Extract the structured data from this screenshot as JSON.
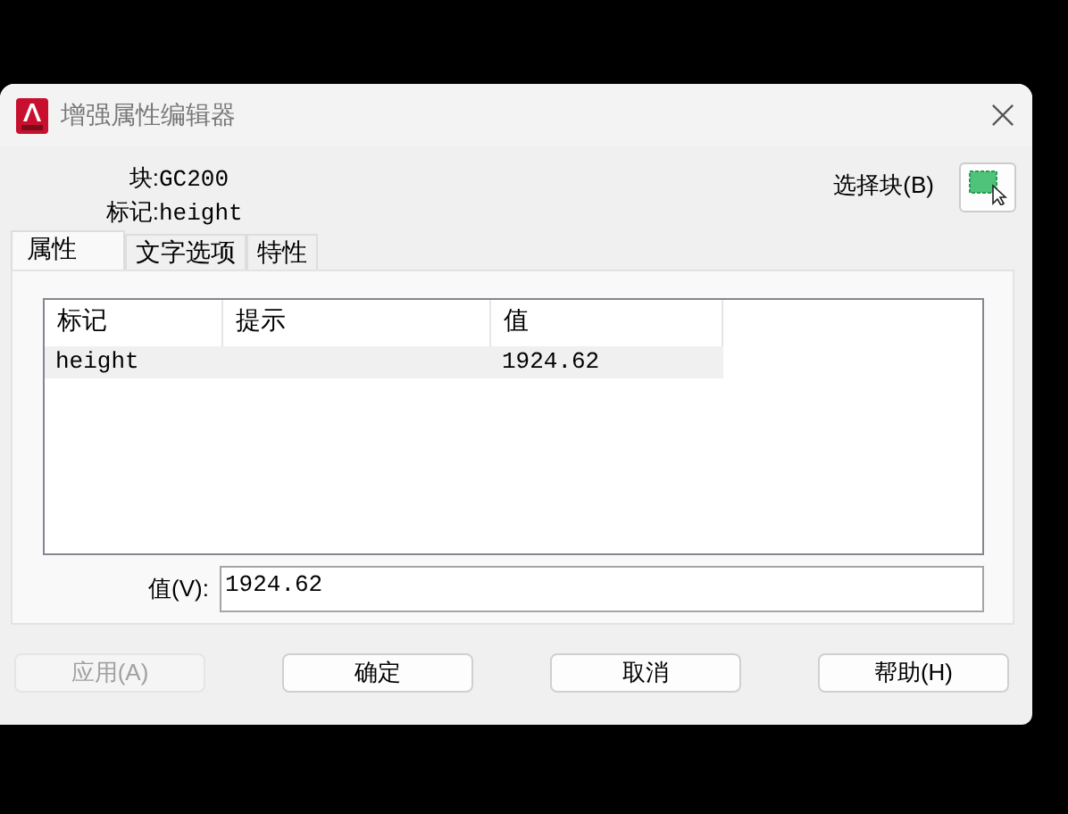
{
  "window": {
    "title": "增强属性编辑器"
  },
  "info": [
    {
      "label": "块:",
      "value": "GC200"
    },
    {
      "label": "标记:",
      "value": "height"
    }
  ],
  "select_block": {
    "label": "选择块(B)"
  },
  "tabs": [
    {
      "label": "属性",
      "selected": true
    },
    {
      "label": "文字选项",
      "selected": false
    },
    {
      "label": "特性",
      "selected": false
    }
  ],
  "table": {
    "columns": [
      "标记",
      "提示",
      "值"
    ],
    "rows": [
      {
        "tag": "height",
        "value": "1924.62",
        "selected": true
      }
    ]
  },
  "value_field": {
    "label": "值(V):",
    "value": "1924.62"
  },
  "buttons": [
    {
      "label": "应用(A)",
      "disabled": true
    },
    {
      "label": "确定",
      "disabled": false
    },
    {
      "label": "取消",
      "disabled": false
    },
    {
      "label": "帮助(H)",
      "disabled": false
    }
  ]
}
